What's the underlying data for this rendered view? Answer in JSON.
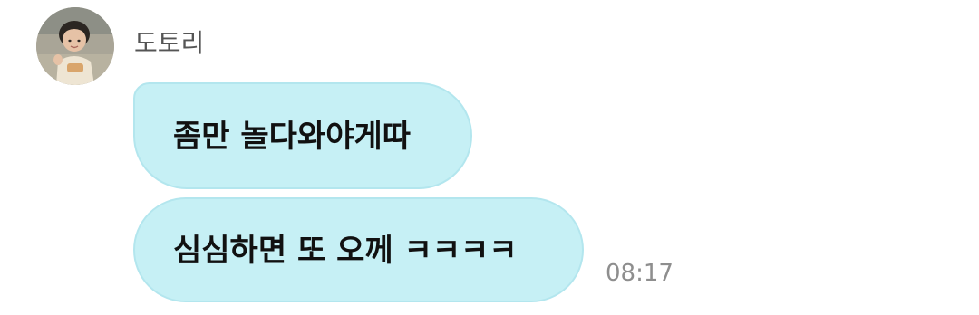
{
  "message_group": {
    "sender": {
      "name": "도토리",
      "avatar_icon": "child-photo-avatar"
    },
    "messages": [
      {
        "text": "좀만 놀다와야게따"
      },
      {
        "text": "심심하면 또 오께 ㅋㅋㅋㅋ"
      }
    ],
    "timestamp": "08:17"
  },
  "colors": {
    "bubble_fill": "#c6f0f5",
    "bubble_border": "#b3e6ee",
    "sender_name": "#555555",
    "timestamp": "#8e8e8e"
  }
}
